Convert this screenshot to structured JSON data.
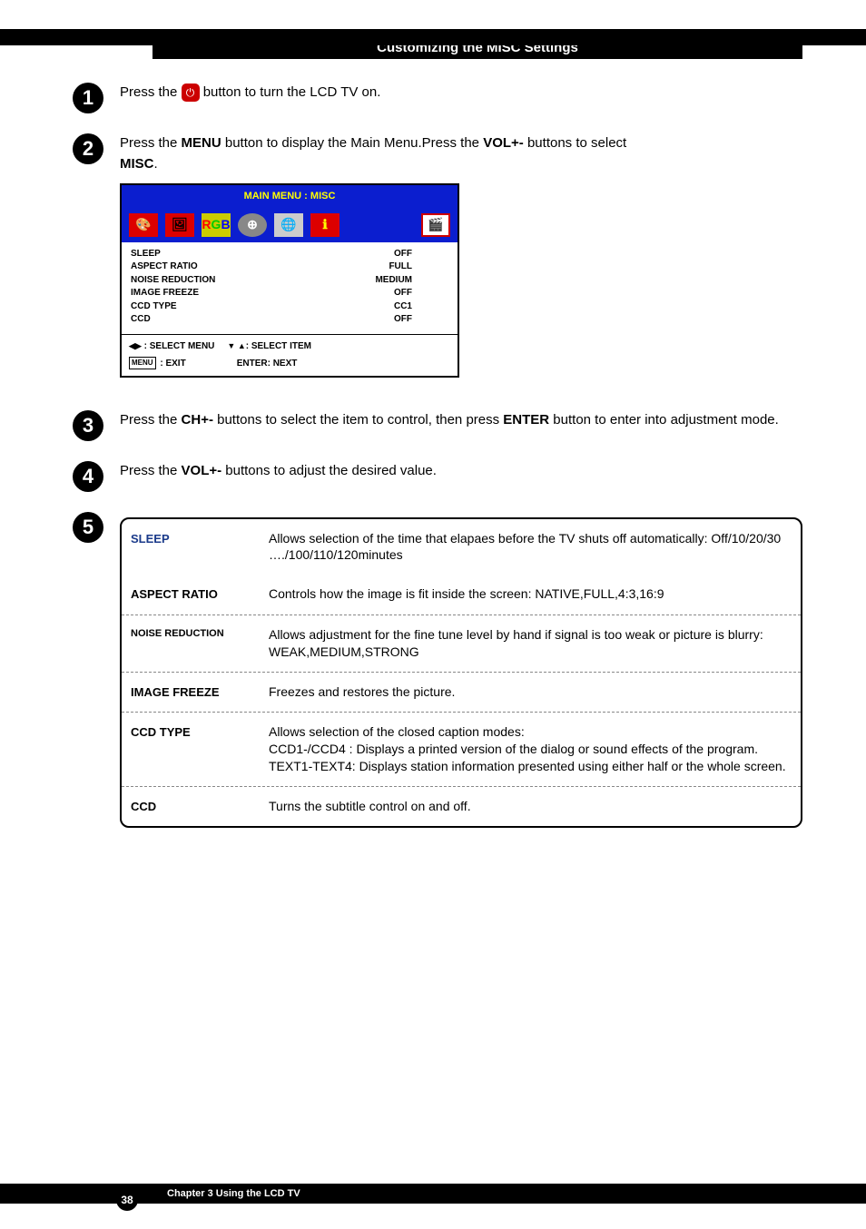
{
  "section_title": "Customizing the MISC Settings",
  "steps": {
    "s1": {
      "num": "1",
      "before": "Press the ",
      "after": " button to turn the LCD TV on."
    },
    "s2": {
      "num": "2",
      "line1a": "Press the ",
      "menu": "MENU",
      "line1b": " button to display the Main Menu.Press the ",
      "vol": "VOL+-",
      "line1c": " buttons to select ",
      "misc": "MISC",
      "line1d": "."
    },
    "s3": {
      "num": "3",
      "a": "Press the ",
      "ch": "CH+-",
      "b": " buttons to select the item to control, then press ",
      "enter": "ENTER",
      "c": " button to enter into adjustment mode."
    },
    "s4": {
      "num": "4",
      "a": "Press the ",
      "vol": "VOL+-",
      "b": " buttons to adjust the desired value."
    },
    "s5": {
      "num": "5"
    }
  },
  "osd": {
    "title": "MAIN MENU : MISC",
    "rows": [
      {
        "k": "SLEEP",
        "v": "OFF"
      },
      {
        "k": "ASPECT RATIO",
        "v": "FULL"
      },
      {
        "k": "NOISE REDUCTION",
        "v": "MEDIUM"
      },
      {
        "k": "IMAGE FREEZE",
        "v": "OFF"
      },
      {
        "k": "CCD TYPE",
        "v": "CC1"
      },
      {
        "k": "CCD",
        "v": "OFF"
      }
    ],
    "foot_select_menu": ": SELECT MENU",
    "foot_select_item": ": SELECT ITEM",
    "foot_exit": " : EXIT",
    "foot_enter": "ENTER: NEXT",
    "menu_key": "MENU"
  },
  "defs": [
    {
      "label": "SLEEP",
      "text": "Allows selection of the time that elapaes before the TV shuts off automatically: Off/10/20/30 …./100/110/120minutes"
    },
    {
      "label": "ASPECT RATIO",
      "text": "Controls how the image is fit inside the screen: NATIVE,FULL,4:3,16:9"
    },
    {
      "label": "NOISE REDUCTION",
      "text": "Allows adjustment for the fine tune level by hand if signal is too weak or picture is blurry: WEAK,MEDIUM,STRONG"
    },
    {
      "label": "IMAGE FREEZE",
      "text": " Freezes and restores the picture."
    },
    {
      "label": "CCD TYPE",
      "text": "Allows selection of the closed caption modes:\nCCD1-/CCD4 : Displays a printed version of the dialog or sound effects of the program.\nTEXT1-TEXT4: Displays station information presented using either half or the whole screen."
    },
    {
      "label": "CCD",
      "text": "Turns the subtitle control on and off."
    }
  ],
  "footer": {
    "page": "38",
    "chapter": "Chapter 3 Using the LCD TV"
  }
}
